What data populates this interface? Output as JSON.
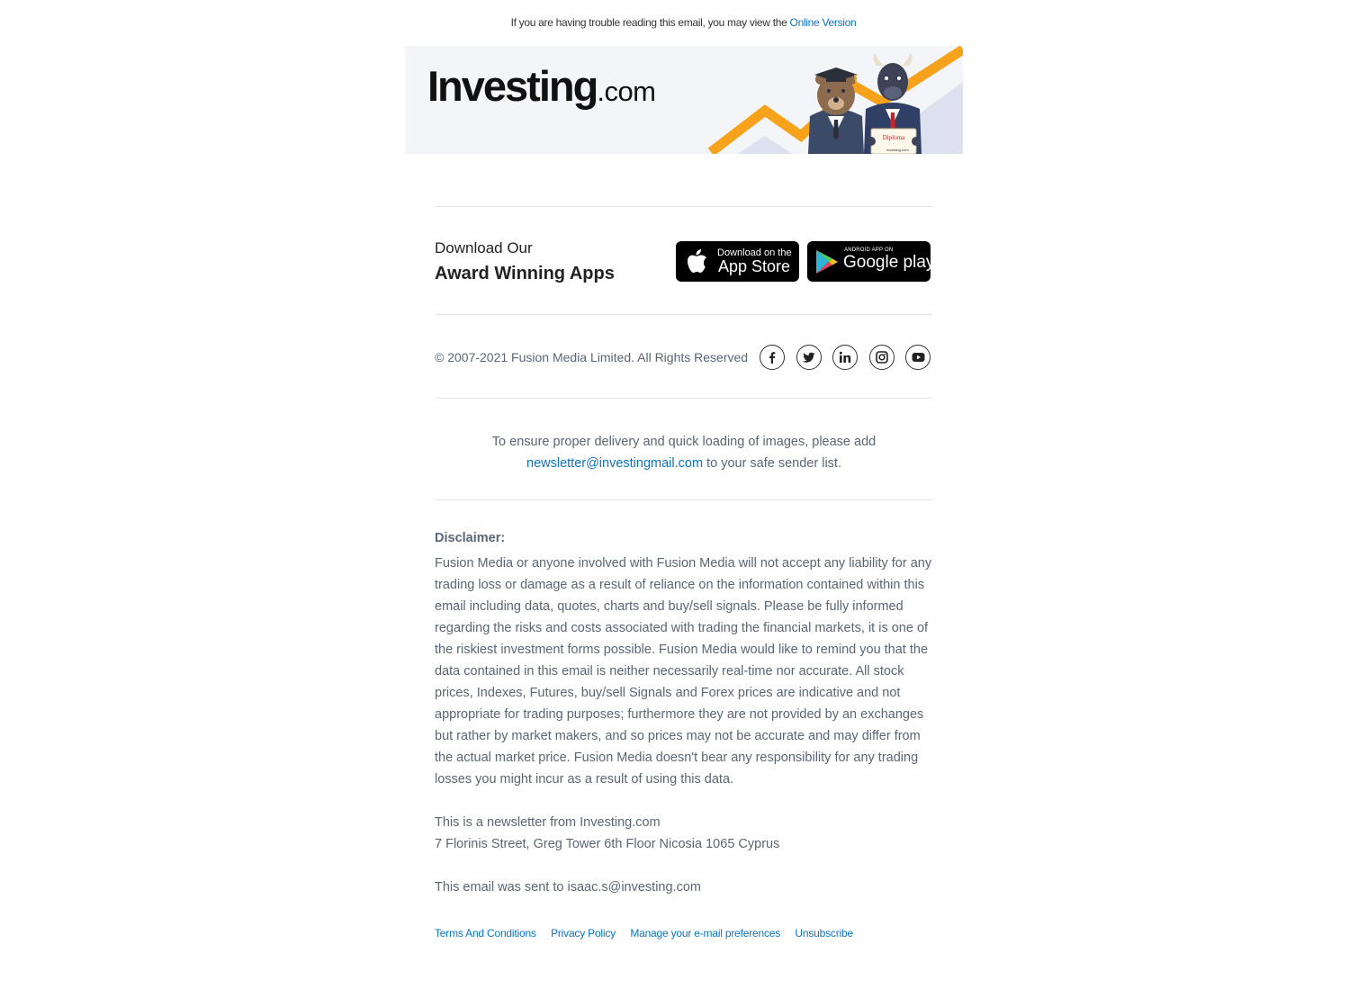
{
  "preheader": {
    "text": "If you are having trouble reading this email, you may view the",
    "link_label": "Online Version"
  },
  "header": {
    "logo_brand": "Investing",
    "logo_suffix": ".com",
    "illustration_badge": "Diploma",
    "illustration_caption": "Investing.com"
  },
  "apps": {
    "title_line1": "Download Our",
    "title_line2": "Award Winning Apps",
    "app_store": {
      "small": "Download on the",
      "big": "App Store"
    },
    "google_play": {
      "small": "ANDROID APP ON",
      "big": "Google play"
    }
  },
  "footer_social": {
    "copyright": "© 2007-2021 Fusion Media Limited. All Rights Reserved",
    "icons": [
      "facebook-icon",
      "twitter-icon",
      "linkedin-icon",
      "instagram-icon",
      "youtube-icon"
    ]
  },
  "safe_sender": {
    "line1": "To ensure proper delivery and quick loading of images, please add",
    "email": "newsletter@investingmail.com",
    "line2_suffix": " to your safe sender list."
  },
  "disclaimer": {
    "title": "Disclaimer:",
    "body": "Fusion Media or anyone involved with Fusion Media will not accept any liability for any trading loss or damage as a result of reliance on the information contained within this email including data, quotes, charts and buy/sell signals. Please be fully informed regarding the risks and costs associated with trading the financial markets, it is one of the riskiest investment forms possible. Fusion Media would like to remind you that the data contained in this email is neither necessarily real-time nor accurate. All stock prices, Indexes, Futures, buy/sell Signals and Forex prices are indicative and not appropriate for trading purposes; furthermore they are not provided by an exchanges but rather by market makers, and so prices may not be accurate and may differ from the actual market price. Fusion Media doesn't bear any responsibility for any trading losses you might incur as a result of using this data."
  },
  "newsletter": {
    "from": "This is a newsletter from Investing.com",
    "address": "7 Florinis Street, Greg Tower 6th Floor Nicosia 1065 Cyprus",
    "sent_to": "This email was sent to isaac.s@investing.com"
  },
  "footer_links": {
    "terms": "Terms And Conditions",
    "privacy": "Privacy Policy",
    "preferences": "Manage your e-mail preferences",
    "unsubscribe": "Unsubscribe"
  },
  "colors": {
    "link": "#0a74c4",
    "text": "#5b6673",
    "accent_orange": "#f7a21b",
    "banner_bg": "#f4f5f9"
  }
}
